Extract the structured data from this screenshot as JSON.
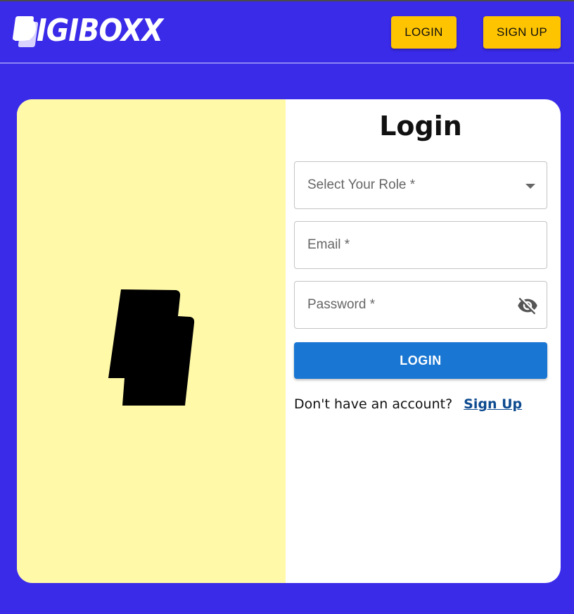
{
  "header": {
    "logo_text": "DIGIBOXX",
    "login_label": "LOGIN",
    "signup_label": "SIGN UP"
  },
  "form": {
    "title": "Login",
    "role_label": "Select Your Role *",
    "email_label": "Email *",
    "password_label": "Password *",
    "submit_label": "LOGIN",
    "account_prompt": "Don't have an account?",
    "signup_link": "Sign Up"
  },
  "colors": {
    "background": "#3a2be8",
    "header_button": "#ffc400",
    "left_panel": "#fff9a8",
    "submit_button": "#1976d2",
    "link": "#0d4a8f"
  },
  "icons": {
    "role_select": "chevron-down-icon",
    "password_toggle": "eye-off-icon",
    "illustration": "logo-illustration"
  }
}
